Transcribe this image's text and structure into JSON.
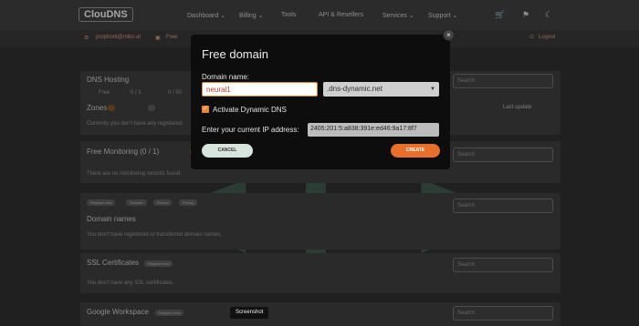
{
  "nav": {
    "logo": "ClouDNS",
    "items": [
      "Dashboard ⌄",
      "Billing ⌄",
      "Tools",
      "API & Resellers",
      "Services ⌄",
      "Support ⌄"
    ],
    "cart_icon": "cart-icon",
    "theme_icon": "moon-icon"
  },
  "subbar": {
    "email": "prophont@mlko.at",
    "plan": "Free",
    "logout": "Logout"
  },
  "panels": {
    "dns_hosting": {
      "title": "DNS Hosting",
      "stat_free": "Free",
      "stat_zones": "0 / 1",
      "stat_records": "0 / 50",
      "zones_label": "Zones",
      "empty": "Currently you don't have any registered",
      "last_update": "Last update",
      "search_placeholder": "Search"
    },
    "monitoring": {
      "title": "Free Monitoring (0 / 1)",
      "empty": "There are no monitoring records found.",
      "search_placeholder": "Search"
    },
    "domains": {
      "tags": [
        "Register new",
        "Transfer",
        "Renew",
        "Pricing"
      ],
      "title": "Domain names",
      "empty": "You don't have registered or transferred domain names.",
      "search_placeholder": "Search"
    },
    "ssl": {
      "title": "SSL Certificates",
      "tag": "Register new",
      "empty": "You don't have any SSL certificates.",
      "search_placeholder": "Search"
    },
    "workspace": {
      "title": "Google Workspace",
      "tag": "Register new",
      "search_placeholder": "Search"
    }
  },
  "modal": {
    "title": "Free domain",
    "close": "×",
    "domain_label": "Domain name:",
    "domain_value": "neural1",
    "domain_suffix": ".dns-dynamic.net",
    "dynamic_label": "Activate Dynamic DNS",
    "dynamic_checked": true,
    "ip_label": "Enter your current IP address:",
    "ip_value": "2405:201:5:a838:391e:ed46:9a17:8f7",
    "cancel": "CANCEL",
    "create": "CREATE",
    "accent_color": "#e8702a"
  },
  "tooltip": "Screenshot"
}
